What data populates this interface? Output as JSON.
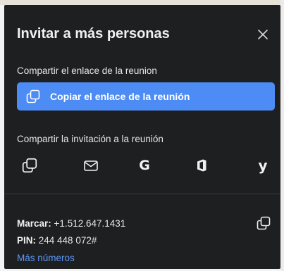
{
  "dialog": {
    "title": "Invitar a más personas",
    "close_icon": "close-icon",
    "colors": {
      "background": "#1e1f21",
      "accent": "#4e8cf5",
      "link": "#5b97f7"
    }
  },
  "link_section": {
    "label": "Compartir el enlace de la reunion",
    "copy_button": {
      "label": "Copiar el enlace de la reunión",
      "icon": "copy-icon"
    }
  },
  "invite_section": {
    "label": "Compartir la invitación a la reunión",
    "options": [
      {
        "name": "copy-invitation",
        "icon": "copy-icon"
      },
      {
        "name": "email",
        "icon": "mail-icon"
      },
      {
        "name": "google",
        "icon": "google-icon",
        "glyph": "G"
      },
      {
        "name": "office",
        "icon": "office-icon"
      },
      {
        "name": "yahoo",
        "icon": "yahoo-icon",
        "glyph": "y"
      }
    ]
  },
  "dial_in": {
    "dial_label": "Marcar:",
    "dial_number": "+1.512.647.1431",
    "pin_label": "PIN:",
    "pin_value": "244 448 072#",
    "more_numbers": "Más números",
    "copy_icon": "copy-icon"
  }
}
